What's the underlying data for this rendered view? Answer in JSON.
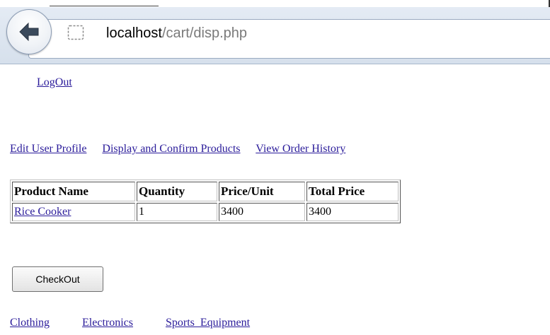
{
  "browser": {
    "url_host": "localhost",
    "url_path": "/cart/disp.php",
    "back_icon": "back-arrow-icon",
    "site_icon": "page-icon"
  },
  "page": {
    "logout_label": "LogOut",
    "menu": [
      {
        "label": "Edit User Profile"
      },
      {
        "label": "Display and Confirm Products"
      },
      {
        "label": "View Order History"
      }
    ],
    "cart_table": {
      "headers": [
        "Product Name",
        "Quantity",
        "Price/Unit",
        "Total Price"
      ],
      "rows": [
        {
          "product": "Rice Cooker",
          "quantity": "1",
          "price_unit": "3400",
          "total_price": "3400"
        }
      ]
    },
    "checkout_label": "CheckOut",
    "categories": [
      {
        "label": "Clothing"
      },
      {
        "label": "Electronics"
      },
      {
        "label": "Sports_Equipment"
      }
    ]
  },
  "colors": {
    "link": "#2a1b9a",
    "chrome_bg": "#dce5f0",
    "url_path": "#7a7a7a"
  }
}
